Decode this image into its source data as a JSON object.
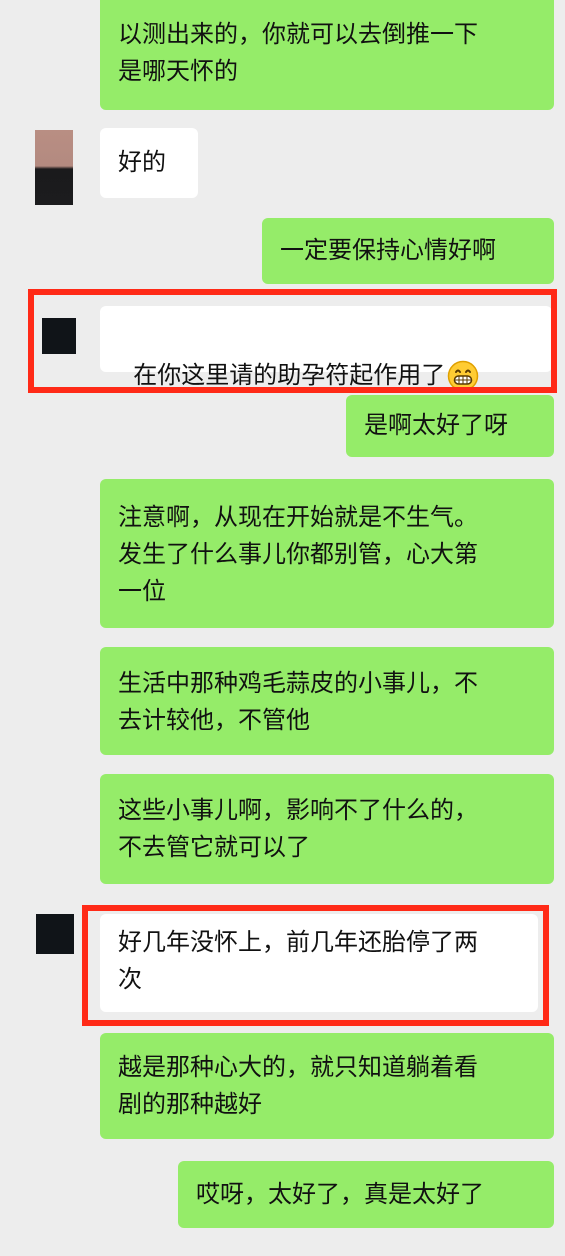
{
  "chat": {
    "messages": [
      {
        "id": "m1",
        "side": "out",
        "text": "以测出来的，你就可以去倒推一下\n是哪天怀的"
      },
      {
        "id": "m2",
        "side": "in",
        "text": "好的"
      },
      {
        "id": "m3",
        "side": "out",
        "text": "一定要保持心情好啊"
      },
      {
        "id": "m4",
        "side": "in",
        "text": "在你这里请的助孕符起作用了",
        "emoji": "grinning-face-icon",
        "highlighted": true
      },
      {
        "id": "m5",
        "side": "out",
        "text": "是啊太好了呀"
      },
      {
        "id": "m6",
        "side": "out",
        "text": "注意啊，从现在开始就是不生气。\n发生了什么事儿你都别管，心大第\n一位"
      },
      {
        "id": "m7",
        "side": "out",
        "text": "生活中那种鸡毛蒜皮的小事儿，不\n去计较他，不管他"
      },
      {
        "id": "m8",
        "side": "out",
        "text": "这些小事儿啊，影响不了什么的，\n不去管它就可以了"
      },
      {
        "id": "m9",
        "side": "in",
        "text": "好几年没怀上，前几年还胎停了两\n次",
        "highlighted": true
      },
      {
        "id": "m10",
        "side": "out",
        "text": "越是那种心大的，就只知道躺着看\n剧的那种越好"
      },
      {
        "id": "m11",
        "side": "out",
        "text": "哎呀，太好了，真是太好了"
      }
    ]
  },
  "colors": {
    "background": "#ededed",
    "outgoing_bubble": "#95ec69",
    "incoming_bubble": "#ffffff",
    "highlight_box": "#ff2a17"
  }
}
